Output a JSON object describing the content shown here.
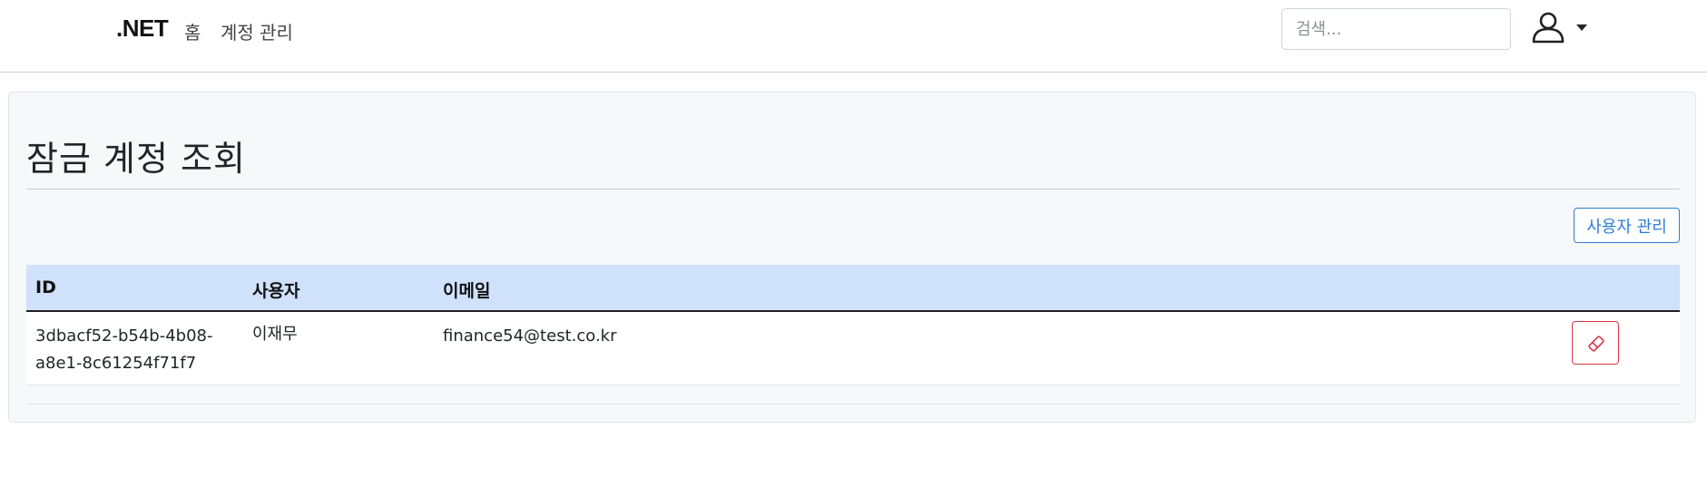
{
  "navbar": {
    "brand": ".NET",
    "links": [
      {
        "label": "홈"
      },
      {
        "label": "계정 관리"
      }
    ],
    "search": {
      "placeholder": "검색...",
      "value": ""
    }
  },
  "page": {
    "title": "잠금 계정 조회",
    "manage_button_label": "사용자 관리"
  },
  "table": {
    "columns": [
      "ID",
      "사용자",
      "이메일"
    ],
    "rows": [
      {
        "id": "3dbacf52-b54b-4b08-a8e1-8c61254f71f7",
        "user": "이재무",
        "email": "finance54@test.co.kr"
      }
    ]
  },
  "colors": {
    "accent": "#2f7dd8",
    "danger": "#dc3545",
    "table_header_bg": "#cfe1fb",
    "card_bg": "#f7f8f9"
  },
  "icons": {
    "user_menu": "person-icon",
    "user_menu_caret": "caret-down-icon",
    "row_action": "eraser-icon"
  }
}
